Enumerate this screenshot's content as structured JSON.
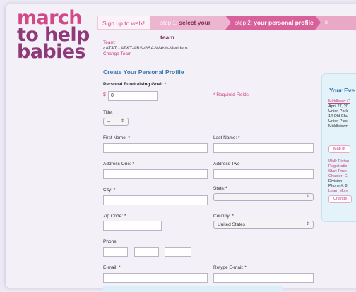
{
  "logo": {
    "line1": "march",
    "line2": "to help",
    "line3": "babies"
  },
  "steps": {
    "signup": "Sign up to walk!",
    "step1_prefix": "step 1:",
    "step1_label": "select your team",
    "step2_prefix": "step 2:",
    "step2_label": "your personal profile",
    "step3_prefix": "s"
  },
  "team": {
    "label": "Team:",
    "name": "‹ AT&T - AT&T-ABS-GSA-Walsh-Meriden›",
    "change_link": "Change Team"
  },
  "form": {
    "section_title": "Create Your Personal Profile",
    "goal_label": "Personal Fundraising Goal: *",
    "currency": "$",
    "goal_value": "0",
    "required_note": "* Required Fields",
    "title_label": "Title:",
    "title_value": "--",
    "first_name_label": "First Name: *",
    "last_name_label": "Last Name: *",
    "address_one_label": "Address One: *",
    "address_two_label": "Address Two",
    "city_label": "City: *",
    "state_label": "State:*",
    "zip_label": "Zip Code: *",
    "country_label": "Country: *",
    "country_value": "United States",
    "phone_label": "Phone:",
    "phone_sep": "-",
    "email_label": "E-mail: *",
    "retype_email_label": "Retype E-mail: *"
  },
  "event": {
    "title": "Your Eve",
    "location_link": "Middlesex C",
    "date": "April 27, 20",
    "place1": "Union Park",
    "place2": "14 Old Chu",
    "place3": "Union Plac",
    "place4": "Middletown",
    "map_button": "Map it!",
    "walk_distance": "Walk Distan",
    "registration": "Registratio",
    "start_time": "Start Time:",
    "chapter": "Chapter: G",
    "division": "Division",
    "phone": "Phone #: 8",
    "learn_more": "Learn More",
    "change_button": "Change"
  }
}
